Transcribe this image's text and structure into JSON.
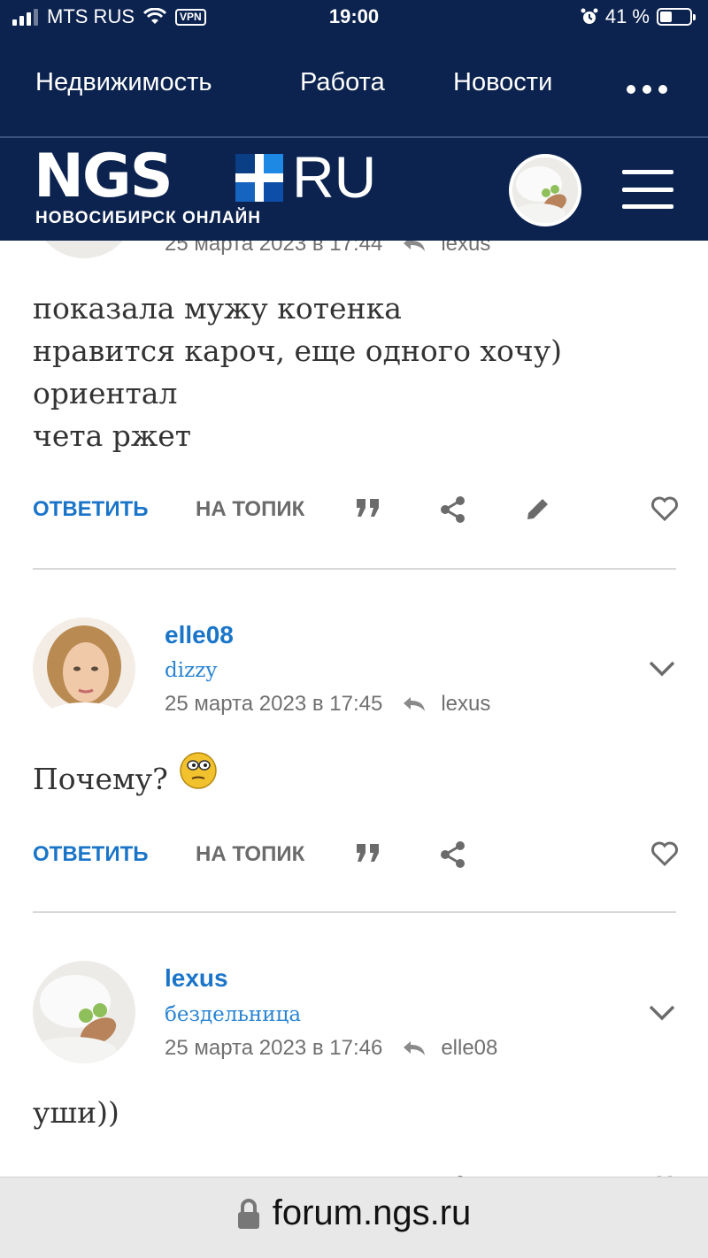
{
  "status_bar": {
    "carrier": "MTS RUS",
    "vpn": "VPN",
    "time": "19:00",
    "battery": "41 %",
    "battery_level": 0.41
  },
  "top_nav": {
    "items": [
      "Недвижимость",
      "Работа",
      "Новости"
    ]
  },
  "logo": {
    "left": "NGS",
    "right": "RU",
    "subtitle": "НОВОСИБИРСК ОНЛАЙН"
  },
  "first_post": {
    "date": "25 марта 2023 в 17:44",
    "reply_to": "lexus",
    "lines": [
      "показала мужу котенка",
      "нравится кароч, еще одного хочу)",
      "ориентал",
      "чета ржет"
    ]
  },
  "actions": {
    "reply": "ОТВЕТИТЬ",
    "topic": "НА ТОПИК"
  },
  "posts": [
    {
      "username": "elle08",
      "status": "dizzy",
      "date": "25 марта 2023 в 17:45",
      "reply_to": "lexus",
      "text": "Почему?"
    },
    {
      "username": "lexus",
      "status": "бездельница",
      "date": "25 марта 2023 в 17:46",
      "reply_to": "elle08",
      "text": "уши))"
    }
  ],
  "url_bar": {
    "url": "forum.ngs.ru"
  },
  "colors": {
    "header_bg": "#0c2350",
    "accent": "#1a75c9",
    "logo_blue": "#1e88e5"
  }
}
